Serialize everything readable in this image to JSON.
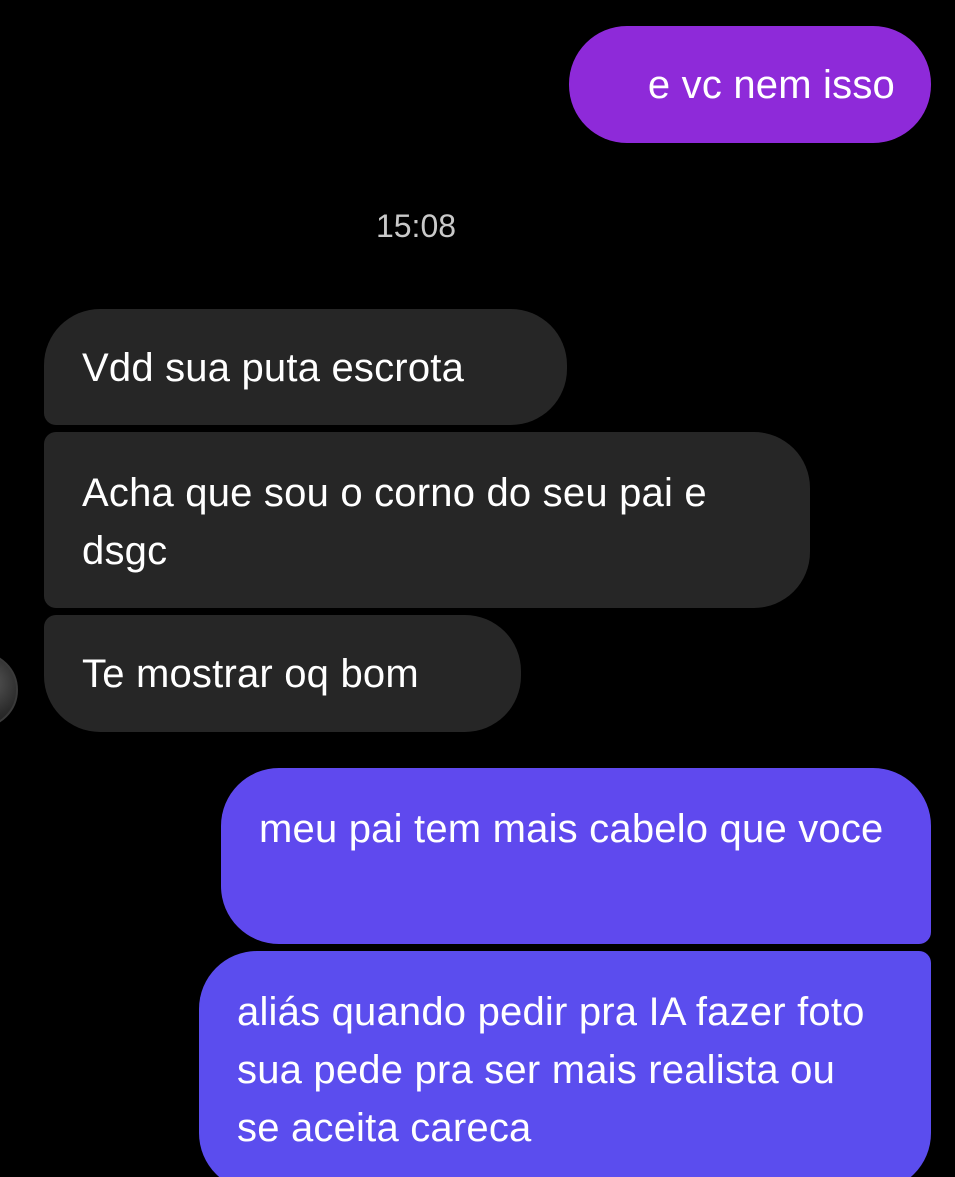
{
  "messages": {
    "sent_1": "e vc nem isso",
    "timestamp": "15:08",
    "received_1": "Vdd sua puta escrota",
    "received_2": "Acha que sou o corno do seu pai e dsgc",
    "received_3": "Te mostrar oq bom",
    "sent_2": "meu pai tem mais cabelo que voce",
    "sent_3": "aliás quando pedir pra IA fazer foto sua pede pra ser mais realista ou se aceita careca"
  },
  "colors": {
    "background": "#000000",
    "received_bubble": "#262626",
    "sent_bubble_violet": "#8e2ad9",
    "sent_bubble_indigo": "#5f49ee",
    "timestamp_text": "#c9c9c9",
    "message_text": "#ffffff"
  },
  "icons": {
    "sender_avatar": "avatar"
  }
}
